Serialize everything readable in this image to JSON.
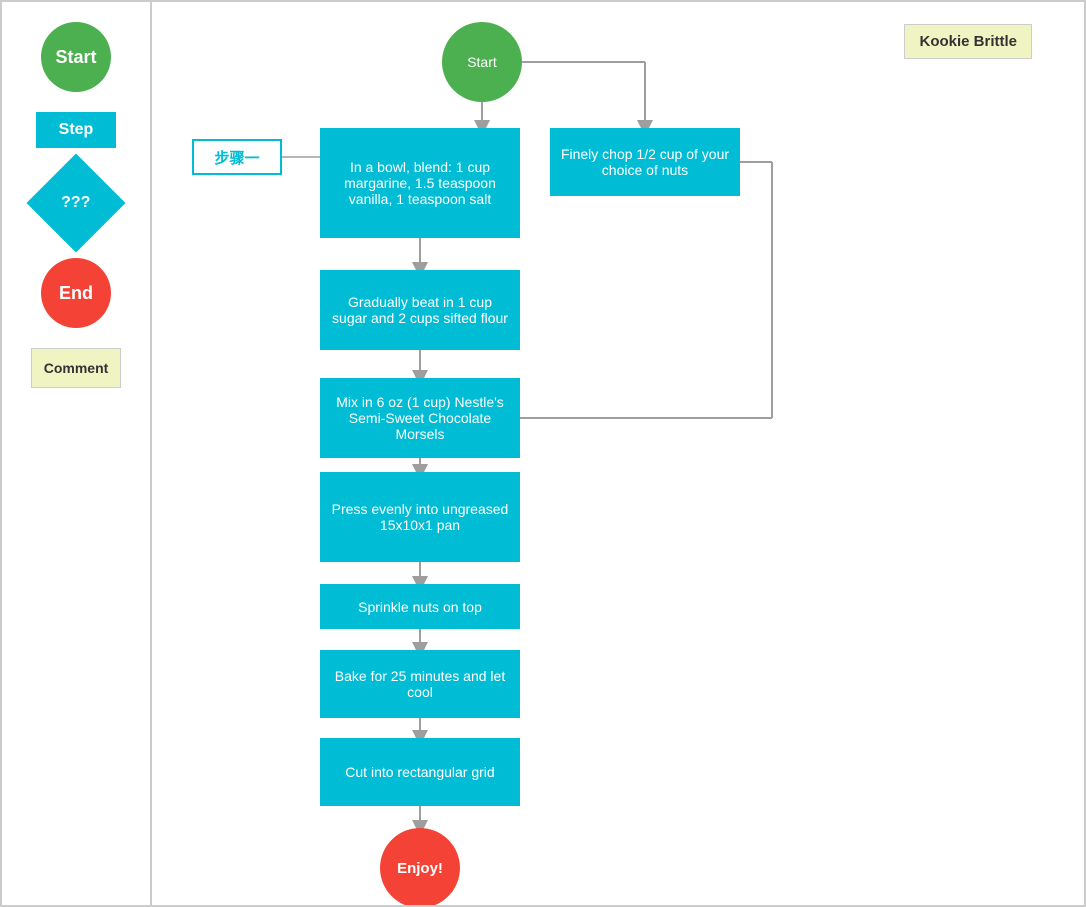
{
  "sidebar": {
    "start_label": "Start",
    "step_label": "Step",
    "decision_label": "???",
    "end_label": "End",
    "comment_label": "Comment"
  },
  "flowchart": {
    "title": "Kookie Brittle",
    "start_label": "Start",
    "end_label": "Enjoy!",
    "chinese_step_label": "步骤一",
    "steps": [
      {
        "id": "step1",
        "text": "In a bowl, blend: 1 cup margarine, 1.5 teaspoon vanilla, 1 teaspoon salt"
      },
      {
        "id": "step_nuts",
        "text": "Finely chop 1/2 cup of your choice of nuts"
      },
      {
        "id": "step2",
        "text": "Gradually beat in 1 cup sugar and 2 cups sifted flour"
      },
      {
        "id": "step3",
        "text": "Mix in 6 oz (1 cup) Nestle's Semi-Sweet Chocolate Morsels"
      },
      {
        "id": "step4",
        "text": "Press evenly into ungreased 15x10x1 pan"
      },
      {
        "id": "step5",
        "text": "Sprinkle nuts on top"
      },
      {
        "id": "step6",
        "text": "Bake for 25 minutes and let cool"
      },
      {
        "id": "step7",
        "text": "Cut into rectangular grid"
      }
    ]
  },
  "colors": {
    "start_green": "#4caf50",
    "step_cyan": "#00bcd4",
    "end_red": "#f44336",
    "comment_yellow": "#f0f4c3",
    "connector_gray": "#9e9e9e"
  }
}
